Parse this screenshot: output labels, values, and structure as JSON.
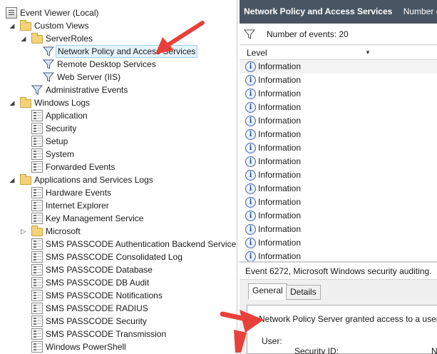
{
  "tree": {
    "items": [
      {
        "label": "Event Viewer (Local)",
        "icon": "event-viewer-icon",
        "indent": 0,
        "expander": "",
        "name": "tree-item-event-viewer-local"
      },
      {
        "label": "Custom Views",
        "icon": "folder-icon",
        "indent": 1,
        "expander": "◢",
        "name": "tree-item-custom-views"
      },
      {
        "label": "ServerRoles",
        "icon": "folder-icon",
        "indent": 2,
        "expander": "◢",
        "name": "tree-item-serverroles"
      },
      {
        "label": "Network Policy and Access Services",
        "icon": "filter-icon",
        "indent": 3,
        "expander": "",
        "name": "tree-item-network-policy",
        "selected": true
      },
      {
        "label": "Remote Desktop Services",
        "icon": "filter-icon",
        "indent": 3,
        "expander": "",
        "name": "tree-item-remote-desktop-services"
      },
      {
        "label": "Web Server (IIS)",
        "icon": "filter-icon",
        "indent": 3,
        "expander": "",
        "name": "tree-item-web-server-iis"
      },
      {
        "label": "Administrative Events",
        "icon": "filter-icon",
        "indent": 2,
        "expander": "",
        "name": "tree-item-administrative-events"
      },
      {
        "label": "Windows Logs",
        "icon": "folder-icon",
        "indent": 1,
        "expander": "◢",
        "name": "tree-item-windows-logs"
      },
      {
        "label": "Application",
        "icon": "log-icon",
        "indent": 2,
        "expander": "",
        "name": "tree-item-application"
      },
      {
        "label": "Security",
        "icon": "log-icon",
        "indent": 2,
        "expander": "",
        "name": "tree-item-security"
      },
      {
        "label": "Setup",
        "icon": "log-icon",
        "indent": 2,
        "expander": "",
        "name": "tree-item-setup"
      },
      {
        "label": "System",
        "icon": "log-icon",
        "indent": 2,
        "expander": "",
        "name": "tree-item-system"
      },
      {
        "label": "Forwarded Events",
        "icon": "log-icon",
        "indent": 2,
        "expander": "",
        "name": "tree-item-forwarded-events"
      },
      {
        "label": "Applications and Services Logs",
        "icon": "folder-icon",
        "indent": 1,
        "expander": "◢",
        "name": "tree-item-applications-and-services-logs"
      },
      {
        "label": "Hardware Events",
        "icon": "log-icon",
        "indent": 2,
        "expander": "",
        "name": "tree-item-hardware-events"
      },
      {
        "label": "Internet Explorer",
        "icon": "log-icon",
        "indent": 2,
        "expander": "",
        "name": "tree-item-internet-explorer"
      },
      {
        "label": "Key Management Service",
        "icon": "log-icon",
        "indent": 2,
        "expander": "",
        "name": "tree-item-key-management-service"
      },
      {
        "label": "Microsoft",
        "icon": "folder-icon",
        "indent": 2,
        "expander": "▷",
        "name": "tree-item-microsoft"
      },
      {
        "label": "SMS PASSCODE Authentication Backend Service",
        "icon": "log-icon",
        "indent": 2,
        "expander": "",
        "name": "tree-item-sms-passcode-auth-backend"
      },
      {
        "label": "SMS PASSCODE Consolidated Log",
        "icon": "log-icon",
        "indent": 2,
        "expander": "",
        "name": "tree-item-sms-passcode-consolidated-log"
      },
      {
        "label": "SMS PASSCODE Database",
        "icon": "log-icon",
        "indent": 2,
        "expander": "",
        "name": "tree-item-sms-passcode-database"
      },
      {
        "label": "SMS PASSCODE DB Audit",
        "icon": "log-icon",
        "indent": 2,
        "expander": "",
        "name": "tree-item-sms-passcode-db-audit"
      },
      {
        "label": "SMS PASSCODE Notifications",
        "icon": "log-icon",
        "indent": 2,
        "expander": "",
        "name": "tree-item-sms-passcode-notifications"
      },
      {
        "label": "SMS PASSCODE RADIUS",
        "icon": "log-icon",
        "indent": 2,
        "expander": "",
        "name": "tree-item-sms-passcode-radius"
      },
      {
        "label": "SMS PASSCODE Security",
        "icon": "log-icon",
        "indent": 2,
        "expander": "",
        "name": "tree-item-sms-passcode-security"
      },
      {
        "label": "SMS PASSCODE Transmission",
        "icon": "log-icon",
        "indent": 2,
        "expander": "",
        "name": "tree-item-sms-passcode-transmission"
      },
      {
        "label": "Windows PowerShell",
        "icon": "log-icon",
        "indent": 2,
        "expander": "",
        "name": "tree-item-windows-powershell"
      }
    ]
  },
  "right_pane": {
    "header_title": "Network Policy and Access Services",
    "header_sub": "Number of",
    "event_count": "Number of events: 20",
    "column_level": "Level",
    "rows": [
      "Information",
      "Information",
      "Information",
      "Information",
      "Information",
      "Information",
      "Information",
      "Information",
      "Information",
      "Information",
      "Information",
      "Information",
      "Information",
      "Information",
      "Information"
    ],
    "event_title": "Event 6272, Microsoft Windows security auditing.",
    "tabs": [
      "General",
      "Details"
    ],
    "detail_message": "Network Policy Server granted access to a user.",
    "detail_user_label": "User:",
    "detail_security_id_label": "Security ID:",
    "detail_security_id_value": "N"
  },
  "colors": {
    "header_bg": "#4a5563",
    "selection_bg": "#e5f3fb",
    "selection_border": "#9ad0f0",
    "arrow_red": "#e8403a"
  },
  "annotations": [
    {
      "type": "arrow",
      "color": "red",
      "target": "tree-item-network-policy"
    },
    {
      "type": "arrow",
      "color": "red",
      "target": "detail-message"
    }
  ]
}
